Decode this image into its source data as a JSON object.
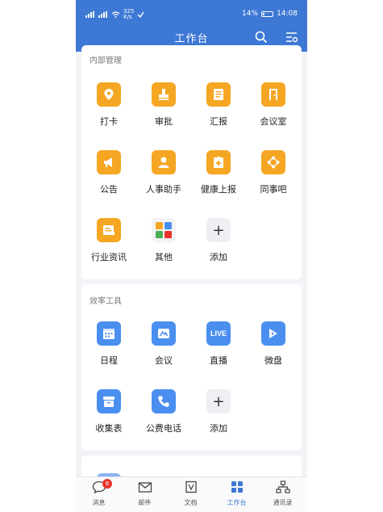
{
  "status_bar": {
    "speed_value": "325",
    "speed_unit": "K/s",
    "battery": "14%",
    "time": "14:08"
  },
  "header": {
    "title": "工作台"
  },
  "section_internal": {
    "title": "内部管理",
    "items": [
      {
        "label": "打卡",
        "icon": "location-pin-icon"
      },
      {
        "label": "审批",
        "icon": "stamp-icon"
      },
      {
        "label": "汇报",
        "icon": "report-doc-icon"
      },
      {
        "label": "会议室",
        "icon": "door-icon"
      },
      {
        "label": "公告",
        "icon": "megaphone-icon"
      },
      {
        "label": "人事助手",
        "icon": "person-icon"
      },
      {
        "label": "健康上报",
        "icon": "medical-kit-icon"
      },
      {
        "label": "同事吧",
        "icon": "network-icon"
      },
      {
        "label": "行业资讯",
        "icon": "news-icon"
      },
      {
        "label": "其他",
        "icon": "apps-grid-icon"
      },
      {
        "label": "添加",
        "icon": "plus-icon"
      }
    ]
  },
  "section_efficiency": {
    "title": "效率工具",
    "items": [
      {
        "label": "日程",
        "icon": "calendar-icon"
      },
      {
        "label": "会议",
        "icon": "meeting-icon"
      },
      {
        "label": "直播",
        "icon": "live-icon",
        "icon_text": "LIVE"
      },
      {
        "label": "微盘",
        "icon": "cloud-drive-icon"
      },
      {
        "label": "收集表",
        "icon": "collection-box-icon"
      },
      {
        "label": "公费电话",
        "icon": "phone-icon"
      },
      {
        "label": "添加",
        "icon": "plus-icon"
      }
    ]
  },
  "tabbar": {
    "items": [
      {
        "label": "消息",
        "badge": "6"
      },
      {
        "label": "邮件"
      },
      {
        "label": "文档"
      },
      {
        "label": "工作台"
      },
      {
        "label": "通讯录"
      }
    ],
    "active": "工作台"
  },
  "colors": {
    "header": "#3d78d4",
    "orange_icon": "#f5a623",
    "blue_icon": "#4a8ff0",
    "badge": "#e5322d"
  }
}
